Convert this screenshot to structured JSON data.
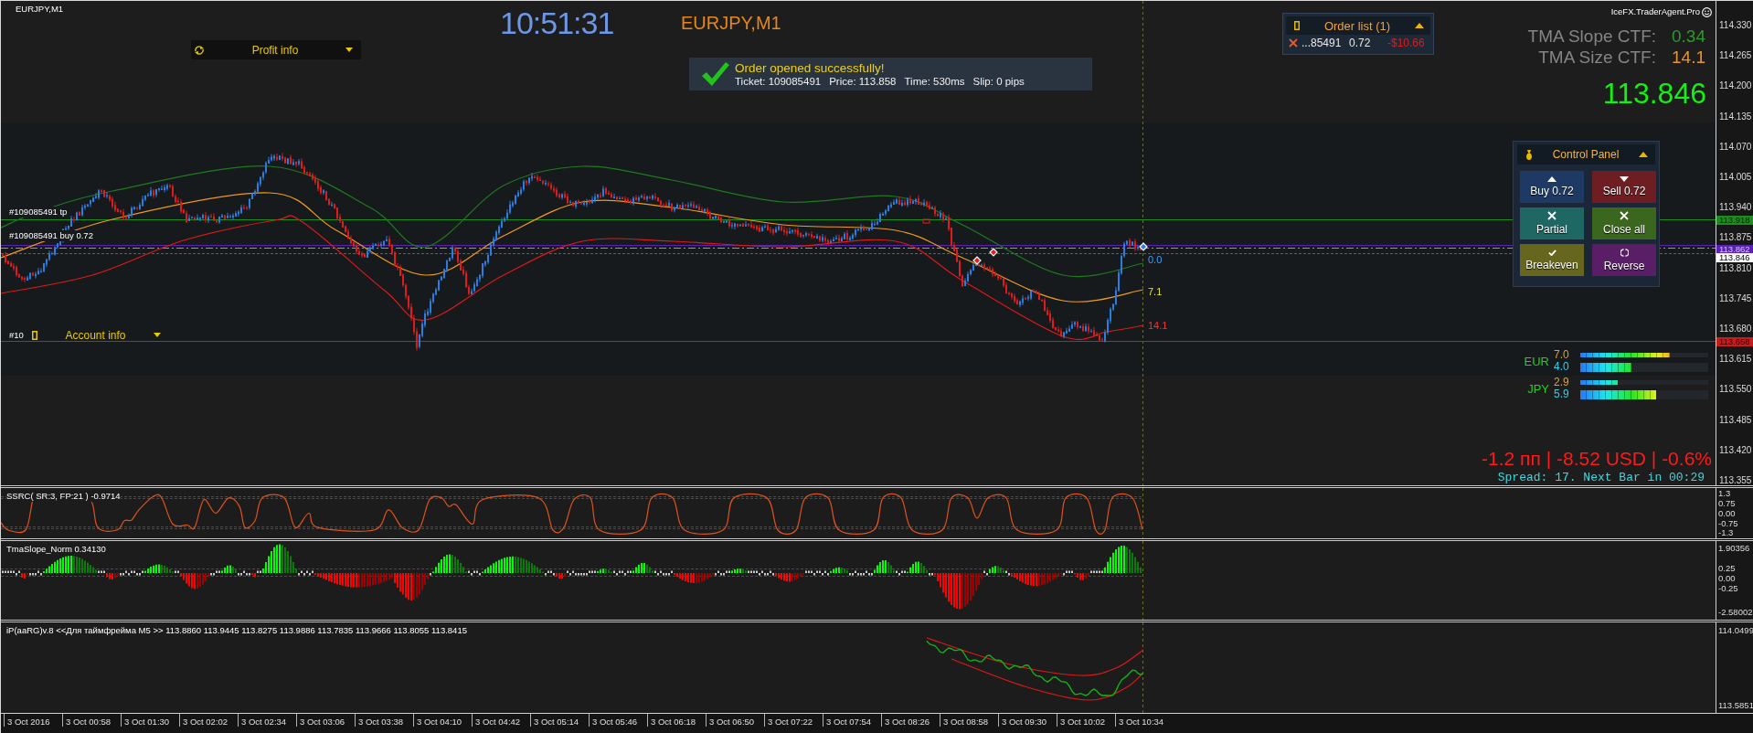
{
  "chart": {
    "title": "EURJPY,M1",
    "clock": "10:51:31",
    "symbol": "EURJPY,M1",
    "branding": "IceFX.TraderAgent.Pro"
  },
  "profit_info": {
    "label": "Profit info",
    "expanded": false
  },
  "notification": {
    "title": "Order opened successfully!",
    "fields": [
      "Ticket: 109085491",
      "Price: 113.858",
      "Time: 530ms",
      "Slip: 0 pips"
    ]
  },
  "order_list": {
    "title": "Order list (1)",
    "expanded": true,
    "orders": [
      {
        "ticket": "...85491",
        "lots": "0.72",
        "profit": "-$10.66"
      }
    ]
  },
  "tma": [
    {
      "label": "TMA Slope CTF:",
      "value": "0.34",
      "color": "#2e9a2e"
    },
    {
      "label": "TMA Size CTF:",
      "value": "14.1",
      "color": "#e8942e"
    }
  ],
  "bid_price": "113.846",
  "control_panel": {
    "title": "Control Panel",
    "expanded": true,
    "buttons": [
      {
        "label": "Buy 0.72",
        "kind": "buy",
        "color": "#1e3a64"
      },
      {
        "label": "Sell 0.72",
        "kind": "sell",
        "color": "#6e1e22"
      },
      {
        "label": "Partial",
        "kind": "partial",
        "color": "#1e6762"
      },
      {
        "label": "Close all",
        "kind": "close_all",
        "color": "#3a661e"
      },
      {
        "label": "Breakeven",
        "kind": "breakeven",
        "color": "#67661e"
      },
      {
        "label": "Reverse",
        "kind": "reverse",
        "color": "#5a1e66"
      }
    ]
  },
  "order_lines": [
    {
      "label": "#109085491 tp",
      "kind": "take_profit"
    },
    {
      "label": "#109085491 buy 0.72",
      "kind": "entry"
    },
    {
      "label": "#10",
      "kind": "stop_loss"
    }
  ],
  "account_info": {
    "label": "Account info",
    "expanded": false
  },
  "band_labels": [
    {
      "value": "0.0",
      "kind": "upper"
    },
    {
      "value": "7.1",
      "kind": "middle"
    },
    {
      "value": "14.1",
      "kind": "lower"
    }
  ],
  "currency_strength": [
    {
      "currency": "EUR",
      "meters": [
        {
          "value": "7.0",
          "level": 0.7
        },
        {
          "value": "4.0",
          "level": 0.4
        }
      ]
    },
    {
      "currency": "JPY",
      "meters": [
        {
          "value": "2.9",
          "level": 0.29
        },
        {
          "value": "5.9",
          "level": 0.59
        }
      ]
    }
  ],
  "profit_summary": "-1.2 пп | -8.52 USD | -0.6%",
  "spread_info": "Spread: 17. Next Bar in 00:29",
  "price_axis": {
    "labels": [
      "114.330",
      "114.265",
      "114.200",
      "114.135",
      "114.070",
      "114.005",
      "113.940",
      "113.875",
      "113.810",
      "113.745",
      "113.680",
      "113.615",
      "113.550",
      "113.485",
      "113.420",
      "113.355"
    ],
    "markers": [
      {
        "value": "113.918",
        "kind": "take_profit"
      },
      {
        "value": "113.862",
        "kind": "order"
      },
      {
        "value": "113.846",
        "kind": "bid"
      },
      {
        "value": "113.658",
        "kind": "stop_loss"
      }
    ]
  },
  "indicators": [
    {
      "kind": "oscillator",
      "title": "SSRC( SR:3, FP:21 ) -0.9714",
      "axis": [
        "1.3",
        "0.75",
        "0.00",
        "-0.75",
        "-1.3"
      ]
    },
    {
      "kind": "histogram",
      "title": "TmaSlope_Norm 0.34130",
      "axis": [
        "1.90356",
        "0.25",
        "0.00",
        "-0.25",
        "-2.58002"
      ]
    },
    {
      "kind": "channel",
      "title": "iP(aaRG)v.8 <<Для таймфрейма M5 >> 113.8860 113.9445 113.8275 113.9886 113.7835 113.9666 113.8055 113.8415",
      "axis": [
        "114.0499",
        "113.5851"
      ]
    }
  ],
  "time_axis": [
    "3 Oct 2016",
    "3 Oct 00:58",
    "3 Oct 01:30",
    "3 Oct 02:02",
    "3 Oct 02:34",
    "3 Oct 03:06",
    "3 Oct 03:38",
    "3 Oct 04:10",
    "3 Oct 04:42",
    "3 Oct 05:14",
    "3 Oct 05:46",
    "3 Oct 06:18",
    "3 Oct 06:50",
    "3 Oct 07:22",
    "3 Oct 07:54",
    "3 Oct 08:26",
    "3 Oct 08:58",
    "3 Oct 09:30",
    "3 Oct 10:02",
    "3 Oct 10:34"
  ]
}
